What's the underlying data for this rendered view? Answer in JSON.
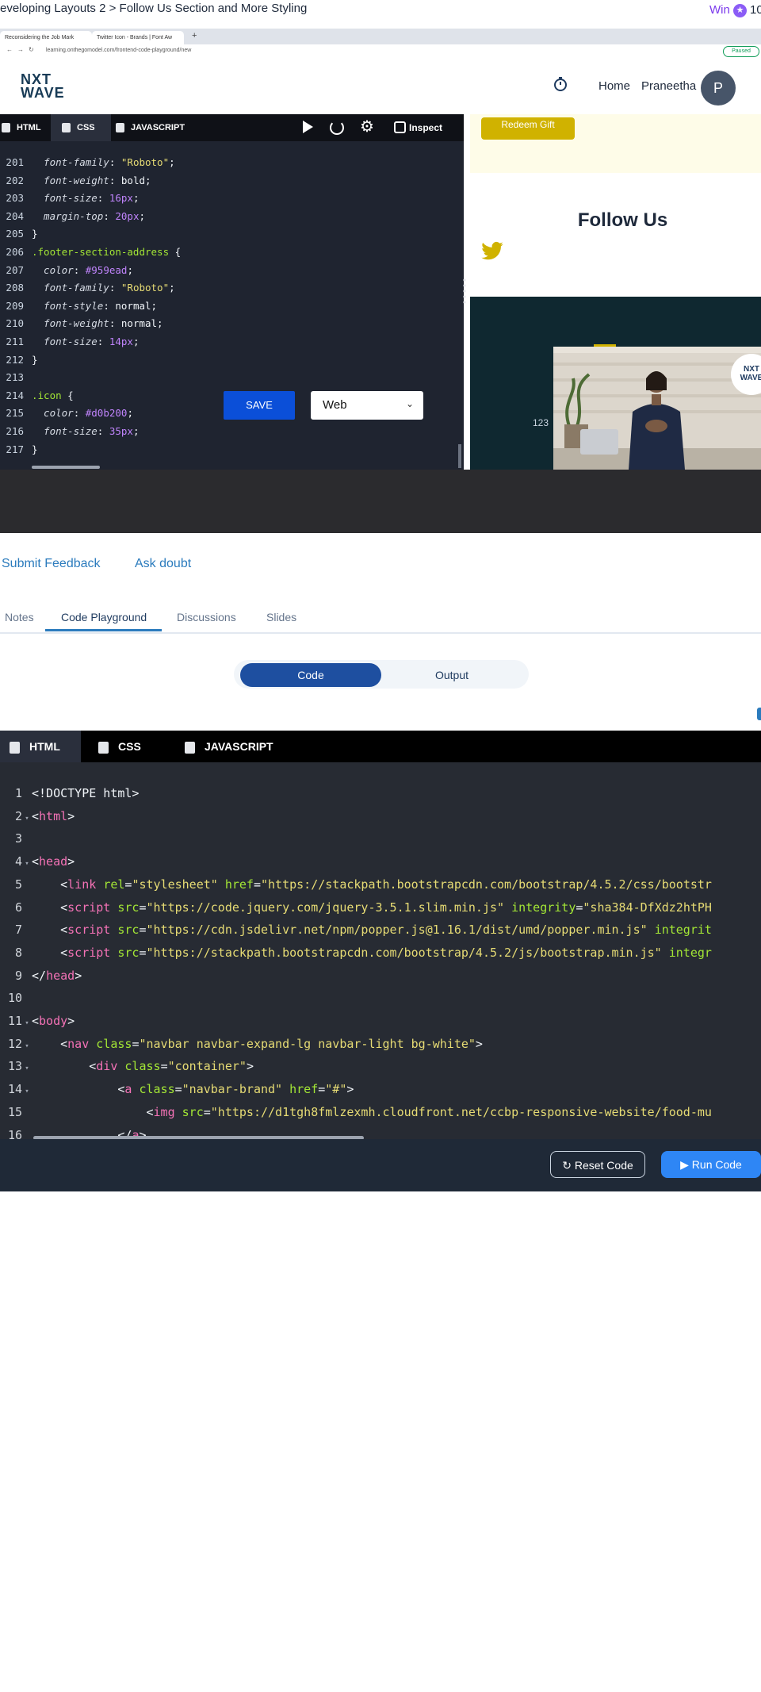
{
  "title_bar": {
    "lesson_title": "eveloping Layouts 2 > Follow Us Section and More Styling",
    "win_label": "Win",
    "win_count": "10"
  },
  "browser": {
    "tabs": [
      "Reconsidering the Job Mark",
      "Twitter Icon - Brands | Font Aw"
    ],
    "url": "learning.onthegomodel.com/frontend-code-playground/new",
    "profile_status": "Paused"
  },
  "app_header": {
    "logo_line1": "NXT",
    "logo_line2": "WAVE",
    "nav_home": "Home",
    "user_name": "Praneetha",
    "avatar_initial": "P"
  },
  "video_editor": {
    "tabs": [
      "HTML",
      "CSS",
      "JAVASCRIPT"
    ],
    "inspect_label": "Inspect",
    "save_label": "SAVE",
    "device_select": "Web",
    "code_lines": [
      {
        "n": "201",
        "parts": [
          {
            "c": "c-prop",
            "t": "  font-family"
          },
          {
            "c": "c-plain",
            "t": ": "
          },
          {
            "c": "c-str",
            "t": "\"Roboto\""
          },
          {
            "c": "c-plain",
            "t": ";"
          }
        ]
      },
      {
        "n": "202",
        "parts": [
          {
            "c": "c-prop",
            "t": "  font-weight"
          },
          {
            "c": "c-plain",
            "t": ": bold;"
          }
        ]
      },
      {
        "n": "203",
        "parts": [
          {
            "c": "c-prop",
            "t": "  font-size"
          },
          {
            "c": "c-plain",
            "t": ": "
          },
          {
            "c": "c-num",
            "t": "16px"
          },
          {
            "c": "c-plain",
            "t": ";"
          }
        ]
      },
      {
        "n": "204",
        "parts": [
          {
            "c": "c-prop",
            "t": "  margin-top"
          },
          {
            "c": "c-plain",
            "t": ": "
          },
          {
            "c": "c-num",
            "t": "20px"
          },
          {
            "c": "c-plain",
            "t": ";"
          }
        ]
      },
      {
        "n": "205",
        "parts": [
          {
            "c": "c-plain",
            "t": "}"
          }
        ]
      },
      {
        "n": "206",
        "parts": [
          {
            "c": "c-sel",
            "t": ".footer-section-address"
          },
          {
            "c": "c-plain",
            "t": " {"
          }
        ]
      },
      {
        "n": "207",
        "parts": [
          {
            "c": "c-prop",
            "t": "  color"
          },
          {
            "c": "c-plain",
            "t": ": "
          },
          {
            "c": "c-hex",
            "t": "#959ead"
          },
          {
            "c": "c-plain",
            "t": ";"
          }
        ]
      },
      {
        "n": "208",
        "parts": [
          {
            "c": "c-prop",
            "t": "  font-family"
          },
          {
            "c": "c-plain",
            "t": ": "
          },
          {
            "c": "c-str",
            "t": "\"Roboto\""
          },
          {
            "c": "c-plain",
            "t": ";"
          }
        ]
      },
      {
        "n": "209",
        "parts": [
          {
            "c": "c-prop",
            "t": "  font-style"
          },
          {
            "c": "c-plain",
            "t": ": normal;"
          }
        ]
      },
      {
        "n": "210",
        "parts": [
          {
            "c": "c-prop",
            "t": "  font-weight"
          },
          {
            "c": "c-plain",
            "t": ": normal;"
          }
        ]
      },
      {
        "n": "211",
        "parts": [
          {
            "c": "c-prop",
            "t": "  font-size"
          },
          {
            "c": "c-plain",
            "t": ": "
          },
          {
            "c": "c-num",
            "t": "14px"
          },
          {
            "c": "c-plain",
            "t": ";"
          }
        ]
      },
      {
        "n": "212",
        "parts": [
          {
            "c": "c-plain",
            "t": "}"
          }
        ]
      },
      {
        "n": "213",
        "parts": []
      },
      {
        "n": "214",
        "parts": [
          {
            "c": "c-sel",
            "t": ".icon"
          },
          {
            "c": "c-plain",
            "t": " {"
          }
        ]
      },
      {
        "n": "215",
        "parts": [
          {
            "c": "c-prop",
            "t": "  color"
          },
          {
            "c": "c-plain",
            "t": ": "
          },
          {
            "c": "c-hex",
            "t": "#d0b200"
          },
          {
            "c": "c-plain",
            "t": ";"
          }
        ]
      },
      {
        "n": "216",
        "parts": [
          {
            "c": "c-prop",
            "t": "  font-size"
          },
          {
            "c": "c-plain",
            "t": ": "
          },
          {
            "c": "c-num",
            "t": "35px"
          },
          {
            "c": "c-plain",
            "t": ";"
          }
        ]
      },
      {
        "n": "217",
        "parts": [
          {
            "c": "c-plain",
            "t": "}"
          }
        ]
      }
    ]
  },
  "video_preview": {
    "redeem_label": "Redeem Gift",
    "heading": "Follow Us",
    "phone_fragment": "123",
    "presenter_logo_line1": "NXT",
    "presenter_logo_line2": "WAVE"
  },
  "actions": {
    "submit_feedback": "Submit Feedback",
    "ask_doubt": "Ask doubt"
  },
  "page_tabs": [
    "Notes",
    "Code Playground",
    "Discussions",
    "Slides"
  ],
  "view_toggle": {
    "code": "Code",
    "output": "Output"
  },
  "editor": {
    "tabs": [
      "HTML",
      "CSS",
      "JAVASCRIPT"
    ],
    "code_lines": [
      {
        "n": "1",
        "f": "",
        "parts": [
          {
            "c": "t-pl",
            "t": "<!DOCTYPE html>"
          }
        ]
      },
      {
        "n": "2",
        "f": "▾",
        "parts": [
          {
            "c": "t-pl",
            "t": "<"
          },
          {
            "c": "t-tag",
            "t": "html"
          },
          {
            "c": "t-pl",
            "t": ">"
          }
        ]
      },
      {
        "n": "3",
        "f": "",
        "parts": []
      },
      {
        "n": "4",
        "f": "▾",
        "parts": [
          {
            "c": "t-pl",
            "t": "<"
          },
          {
            "c": "t-tag",
            "t": "head"
          },
          {
            "c": "t-pl",
            "t": ">"
          }
        ]
      },
      {
        "n": "5",
        "f": "",
        "parts": [
          {
            "c": "t-pl",
            "t": "    <"
          },
          {
            "c": "t-tag",
            "t": "link"
          },
          {
            "c": "t-pl",
            "t": " "
          },
          {
            "c": "t-attr",
            "t": "rel"
          },
          {
            "c": "t-pl",
            "t": "="
          },
          {
            "c": "t-str",
            "t": "\"stylesheet\""
          },
          {
            "c": "t-pl",
            "t": " "
          },
          {
            "c": "t-attr",
            "t": "href"
          },
          {
            "c": "t-pl",
            "t": "="
          },
          {
            "c": "t-str",
            "t": "\"https://stackpath.bootstrapcdn.com/bootstrap/4.5.2/css/bootstr"
          }
        ]
      },
      {
        "n": "6",
        "f": "",
        "parts": [
          {
            "c": "t-pl",
            "t": "    <"
          },
          {
            "c": "t-tag",
            "t": "script"
          },
          {
            "c": "t-pl",
            "t": " "
          },
          {
            "c": "t-attr",
            "t": "src"
          },
          {
            "c": "t-pl",
            "t": "="
          },
          {
            "c": "t-str",
            "t": "\"https://code.jquery.com/jquery-3.5.1.slim.min.js\""
          },
          {
            "c": "t-pl",
            "t": " "
          },
          {
            "c": "t-attr",
            "t": "integrity"
          },
          {
            "c": "t-pl",
            "t": "="
          },
          {
            "c": "t-str",
            "t": "\"sha384-DfXdz2htPH"
          }
        ]
      },
      {
        "n": "7",
        "f": "",
        "parts": [
          {
            "c": "t-pl",
            "t": "    <"
          },
          {
            "c": "t-tag",
            "t": "script"
          },
          {
            "c": "t-pl",
            "t": " "
          },
          {
            "c": "t-attr",
            "t": "src"
          },
          {
            "c": "t-pl",
            "t": "="
          },
          {
            "c": "t-str",
            "t": "\"https://cdn.jsdelivr.net/npm/popper.js@1.16.1/dist/umd/popper.min.js\""
          },
          {
            "c": "t-pl",
            "t": " "
          },
          {
            "c": "t-attr",
            "t": "integrit"
          }
        ]
      },
      {
        "n": "8",
        "f": "",
        "parts": [
          {
            "c": "t-pl",
            "t": "    <"
          },
          {
            "c": "t-tag",
            "t": "script"
          },
          {
            "c": "t-pl",
            "t": " "
          },
          {
            "c": "t-attr",
            "t": "src"
          },
          {
            "c": "t-pl",
            "t": "="
          },
          {
            "c": "t-str",
            "t": "\"https://stackpath.bootstrapcdn.com/bootstrap/4.5.2/js/bootstrap.min.js\""
          },
          {
            "c": "t-pl",
            "t": " "
          },
          {
            "c": "t-attr",
            "t": "integr"
          }
        ]
      },
      {
        "n": "9",
        "f": "",
        "parts": [
          {
            "c": "t-pl",
            "t": "</"
          },
          {
            "c": "t-tag",
            "t": "head"
          },
          {
            "c": "t-pl",
            "t": ">"
          }
        ]
      },
      {
        "n": "10",
        "f": "",
        "parts": []
      },
      {
        "n": "11",
        "f": "▾",
        "parts": [
          {
            "c": "t-pl",
            "t": "<"
          },
          {
            "c": "t-tag",
            "t": "body"
          },
          {
            "c": "t-pl",
            "t": ">"
          }
        ]
      },
      {
        "n": "12",
        "f": "▾",
        "parts": [
          {
            "c": "t-pl",
            "t": "    <"
          },
          {
            "c": "t-tag",
            "t": "nav"
          },
          {
            "c": "t-pl",
            "t": " "
          },
          {
            "c": "t-attr",
            "t": "class"
          },
          {
            "c": "t-pl",
            "t": "="
          },
          {
            "c": "t-str",
            "t": "\"navbar navbar-expand-lg navbar-light bg-white\""
          },
          {
            "c": "t-pl",
            "t": ">"
          }
        ]
      },
      {
        "n": "13",
        "f": "▾",
        "parts": [
          {
            "c": "t-pl",
            "t": "        <"
          },
          {
            "c": "t-tag",
            "t": "div"
          },
          {
            "c": "t-pl",
            "t": " "
          },
          {
            "c": "t-attr",
            "t": "class"
          },
          {
            "c": "t-pl",
            "t": "="
          },
          {
            "c": "t-str",
            "t": "\"container\""
          },
          {
            "c": "t-pl",
            "t": ">"
          }
        ]
      },
      {
        "n": "14",
        "f": "▾",
        "parts": [
          {
            "c": "t-pl",
            "t": "            <"
          },
          {
            "c": "t-tag",
            "t": "a"
          },
          {
            "c": "t-pl",
            "t": " "
          },
          {
            "c": "t-attr",
            "t": "class"
          },
          {
            "c": "t-pl",
            "t": "="
          },
          {
            "c": "t-str",
            "t": "\"navbar-brand\""
          },
          {
            "c": "t-pl",
            "t": " "
          },
          {
            "c": "t-attr",
            "t": "href"
          },
          {
            "c": "t-pl",
            "t": "="
          },
          {
            "c": "t-str",
            "t": "\"#\""
          },
          {
            "c": "t-pl",
            "t": ">"
          }
        ]
      },
      {
        "n": "15",
        "f": "",
        "parts": [
          {
            "c": "t-pl",
            "t": "                <"
          },
          {
            "c": "t-tag",
            "t": "img"
          },
          {
            "c": "t-pl",
            "t": " "
          },
          {
            "c": "t-attr",
            "t": "src"
          },
          {
            "c": "t-pl",
            "t": "="
          },
          {
            "c": "t-str",
            "t": "\"https://d1tgh8fmlzexmh.cloudfront.net/ccbp-responsive-website/food-mu"
          }
        ]
      },
      {
        "n": "16",
        "f": "",
        "parts": [
          {
            "c": "t-pl",
            "t": "            </"
          },
          {
            "c": "t-tag",
            "t": "a"
          },
          {
            "c": "t-pl",
            "t": ">"
          }
        ]
      }
    ],
    "reset_label": "Reset Code",
    "run_label": "Run Code"
  },
  "colors": {
    "accent": "#2b7bbd",
    "toggle_active": "#1e4fa0",
    "run_button": "#2e86f5",
    "icon_yellow": "#d0b200"
  }
}
